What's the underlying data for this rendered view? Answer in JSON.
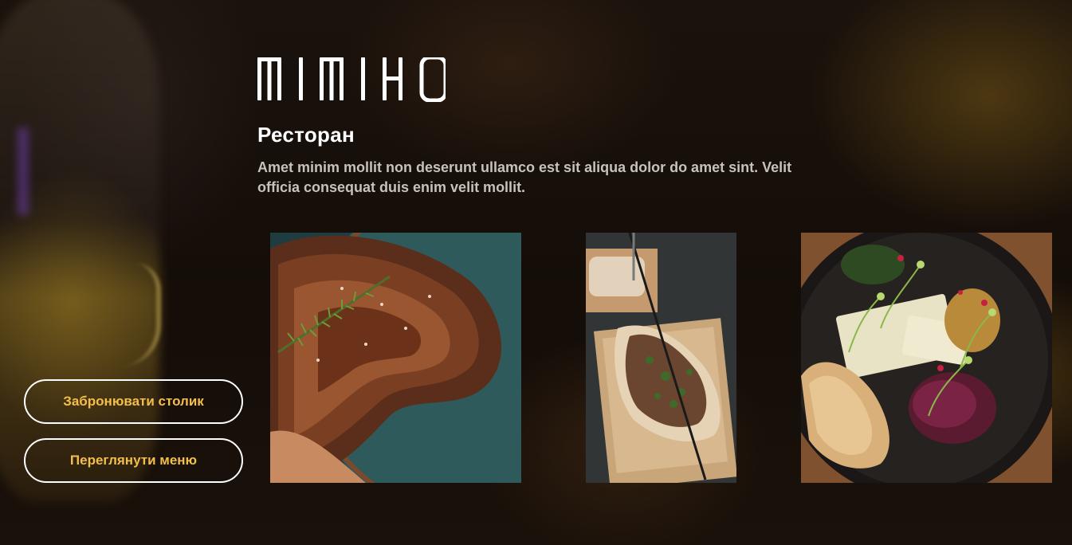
{
  "brand": {
    "logo_text": "MIMIHO"
  },
  "hero": {
    "heading": "Ресторан",
    "description": "Amet minim mollit non deserunt ullamco est sit aliqua dolor do amet sint. Velit officia consequat duis enim velit mollit."
  },
  "actions": {
    "book_table_label": "Забронювати столик",
    "view_menu_label": "Переглянути меню"
  },
  "gallery": {
    "items": [
      {
        "icon": "steak-photo"
      },
      {
        "icon": "flatbread-skewer-photo"
      },
      {
        "icon": "meze-plate-photo"
      }
    ]
  },
  "colors": {
    "accent": "#f2be4c",
    "text": "#ffffff",
    "muted_text": "#c8c2bc",
    "background": "#140d08"
  }
}
